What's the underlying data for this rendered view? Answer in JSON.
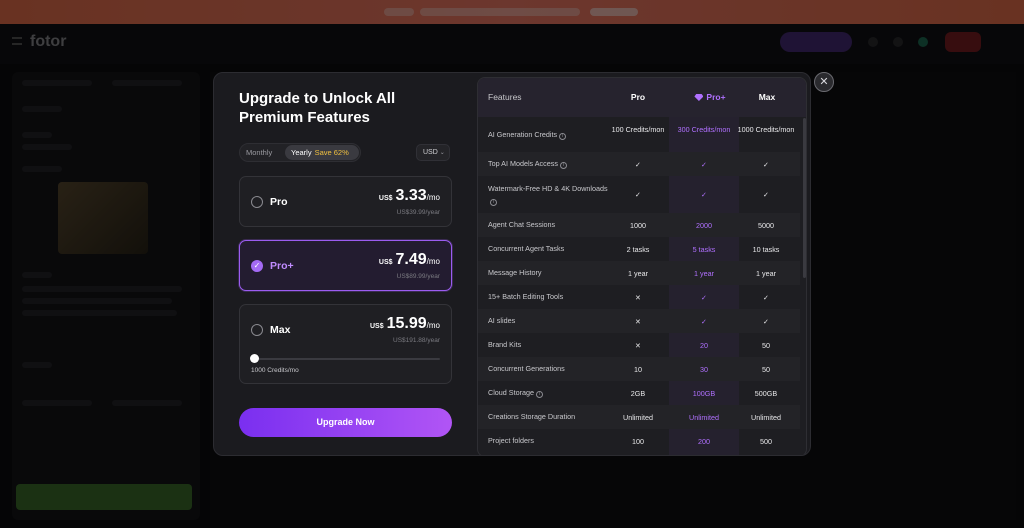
{
  "modal": {
    "title": "Upgrade to Unlock All Premium Features",
    "close_icon": "close-icon",
    "billing": {
      "monthly": "Monthly",
      "yearly": "Yearly",
      "save": "Save 62%",
      "selected": "Yearly"
    },
    "currency": "USD",
    "plans": [
      {
        "name": "Pro",
        "currency": "US$",
        "price": "3.33",
        "per": "/mo",
        "yearly": "US$39.99/year",
        "selected": false
      },
      {
        "name": "Pro+",
        "currency": "US$",
        "price": "7.49",
        "per": "/mo",
        "yearly": "US$89.99/year",
        "selected": true
      },
      {
        "name": "Max",
        "currency": "US$",
        "price": "15.99",
        "per": "/mo",
        "yearly": "US$191.88/year",
        "selected": false,
        "slider_label": "1000 Credits/mo",
        "slider_value": 0
      }
    ],
    "upgrade_button": "Upgrade Now"
  },
  "features": {
    "headers": {
      "feature": "Features",
      "pro": "Pro",
      "proplus": "Pro+",
      "max": "Max"
    },
    "rows": [
      {
        "name": "AI Generation Credits",
        "info": true,
        "pro": "100 Credits/mon",
        "proplus": "300 Credits/mon",
        "max": "1000 Credits/mon"
      },
      {
        "name": "Top AI Models Access",
        "info": true,
        "pro": "✓",
        "proplus": "✓",
        "max": "✓"
      },
      {
        "name": "Watermark-Free HD & 4K Downloads",
        "info": true,
        "pro": "✓",
        "proplus": "✓",
        "max": "✓"
      },
      {
        "name": "Agent Chat Sessions",
        "info": false,
        "pro": "1000",
        "proplus": "2000",
        "max": "5000"
      },
      {
        "name": "Concurrent Agent Tasks",
        "info": false,
        "pro": "2 tasks",
        "proplus": "5 tasks",
        "max": "10 tasks"
      },
      {
        "name": "Message History",
        "info": false,
        "pro": "1 year",
        "proplus": "1 year",
        "max": "1 year"
      },
      {
        "name": "15+ Batch Editing Tools",
        "info": false,
        "pro": "✕",
        "proplus": "✓",
        "max": "✓"
      },
      {
        "name": "AI slides",
        "info": false,
        "pro": "✕",
        "proplus": "✓",
        "max": "✓"
      },
      {
        "name": "Brand Kits",
        "info": false,
        "pro": "✕",
        "proplus": "20",
        "max": "50"
      },
      {
        "name": "Concurrent Generations",
        "info": false,
        "pro": "10",
        "proplus": "30",
        "max": "50"
      },
      {
        "name": "Cloud Storage",
        "info": true,
        "pro": "2GB",
        "proplus": "100GB",
        "max": "500GB"
      },
      {
        "name": "Creations Storage Duration",
        "info": false,
        "pro": "Unlimited",
        "proplus": "Unlimited",
        "max": "Unlimited"
      },
      {
        "name": "Project folders",
        "info": false,
        "pro": "100",
        "proplus": "200",
        "max": "500"
      }
    ]
  },
  "colors": {
    "accent": "#9b5cf0",
    "proplus_text": "#b070ff",
    "save_badge": "#f0c040"
  }
}
